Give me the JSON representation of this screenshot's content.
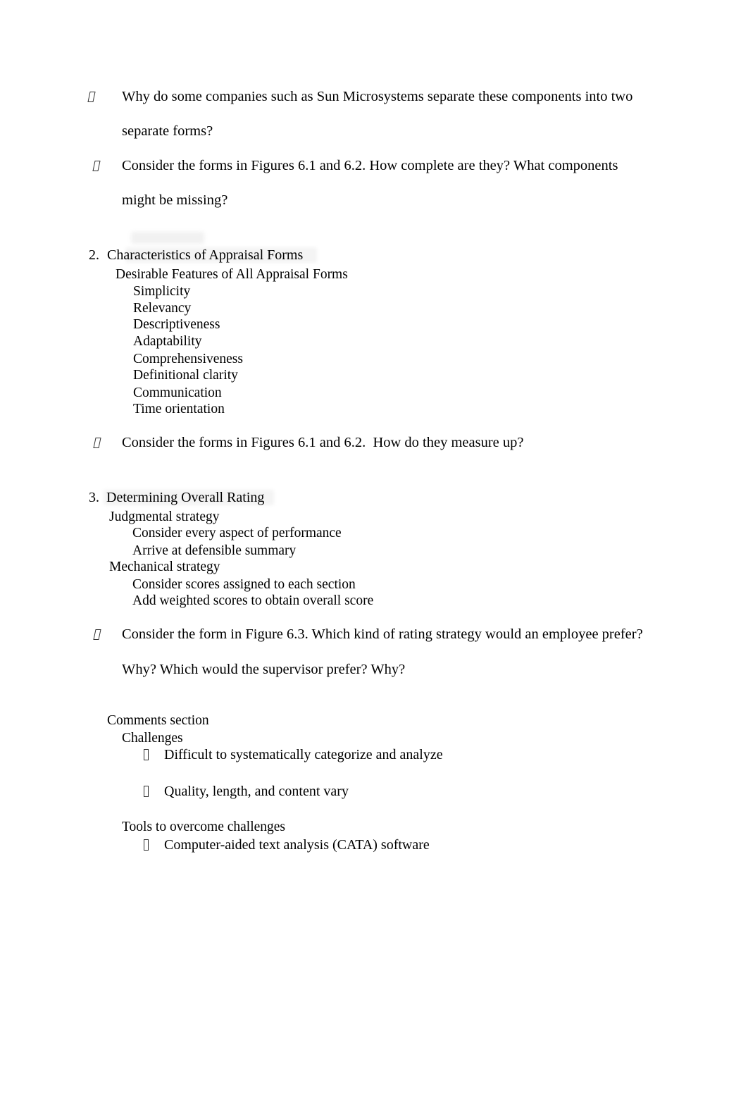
{
  "document": {
    "bullet_glyph": "missing-glyph-box",
    "page_background": "#ffffff",
    "text_color": "#000000",
    "highlight_color": "#f1f1f1"
  },
  "questions_top": [
    {
      "line1": "Why do some companies such as Sun Microsystems separate these components into two",
      "line2": "separate forms?"
    },
    {
      "line1": "Consider the forms in Figures 6.1 and 6.2. How complete are they? What components",
      "line2": "might be missing?"
    }
  ],
  "section2": {
    "number": "2.",
    "heading": "Characteristics of Appraisal Forms",
    "subheading": "Desirable Features of All Appraisal Forms",
    "features": [
      "Simplicity",
      "Relevancy",
      "Descriptiveness",
      "Adaptability",
      "Comprehensiveness",
      "Definitional clarity",
      "Communication",
      "Time orientation"
    ],
    "question": "Consider the forms in Figures 6.1 and 6.2.  How do they measure up?"
  },
  "section3": {
    "number": "3.",
    "heading": "Determining Overall Rating",
    "strategies": [
      {
        "name": "Judgmental strategy",
        "points": [
          "Consider every aspect of performance",
          "Arrive at defensible summary"
        ]
      },
      {
        "name": "Mechanical strategy",
        "points": [
          "Consider scores assigned to each section",
          "Add weighted scores to obtain overall score"
        ]
      }
    ],
    "question": {
      "line1": "Consider the form in Figure 6.3. Which kind of rating strategy would an employee prefer?",
      "line2": "Why? Which would the supervisor prefer? Why?"
    }
  },
  "comments_section": {
    "heading": "Comments section",
    "groups": [
      {
        "name": "Challenges",
        "items": [
          "Difficult to systematically categorize and analyze",
          "Quality, length, and content vary"
        ]
      },
      {
        "name": "Tools to overcome challenges",
        "items": [
          "Computer-aided text analysis (CATA) software"
        ]
      }
    ]
  }
}
